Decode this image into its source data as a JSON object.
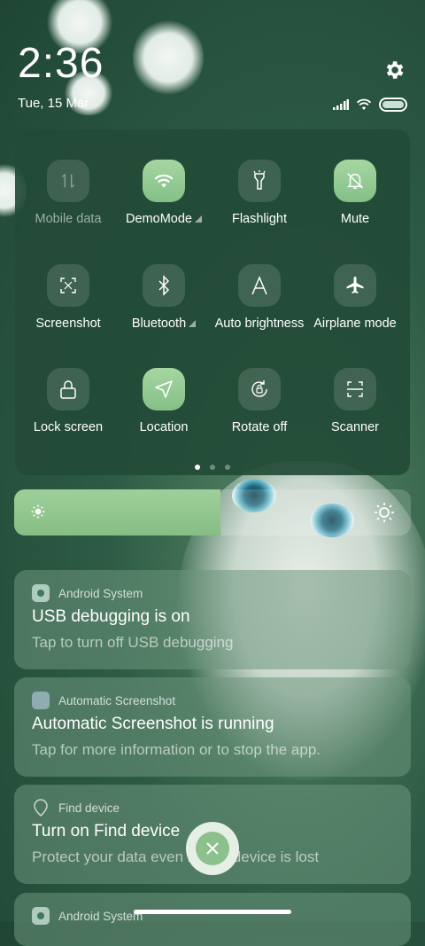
{
  "status_bar": {
    "time": "2:36",
    "date": "Tue, 15 Mar"
  },
  "quick_settings": {
    "tiles": [
      {
        "label": "Mobile data",
        "icon": "mobile-data-icon",
        "active": false,
        "disabled": true
      },
      {
        "label": "DemoMode",
        "icon": "wifi-icon",
        "active": true,
        "expandable": true
      },
      {
        "label": "Flashlight",
        "icon": "flashlight-icon",
        "active": false
      },
      {
        "label": "Mute",
        "icon": "bell-off-icon",
        "active": true
      },
      {
        "label": "Screenshot",
        "icon": "screenshot-icon",
        "active": false
      },
      {
        "label": "Bluetooth",
        "icon": "bluetooth-icon",
        "active": false,
        "expandable": true
      },
      {
        "label": "Auto brightness",
        "icon": "auto-brightness-icon",
        "active": false
      },
      {
        "label": "Airplane mode",
        "icon": "airplane-icon",
        "active": false
      },
      {
        "label": "Lock screen",
        "icon": "lock-icon",
        "active": false
      },
      {
        "label": "Location",
        "icon": "location-icon",
        "active": true
      },
      {
        "label": "Rotate off",
        "icon": "rotate-lock-icon",
        "active": false
      },
      {
        "label": "Scanner",
        "icon": "scanner-icon",
        "active": false
      }
    ],
    "page_count": 3,
    "current_page": 1
  },
  "brightness": {
    "level_fraction": 0.52
  },
  "notifications": [
    {
      "app": "Android System",
      "title": "USB debugging is on",
      "body": "Tap to turn off USB debugging"
    },
    {
      "app": "Automatic Screenshot",
      "title": "Automatic Screenshot is running",
      "body": "Tap for more information or to stop the app."
    },
    {
      "app": "Find device",
      "title": "Turn on Find device",
      "body": "Protect your data even if your device is lost"
    },
    {
      "app": "Android System",
      "title": "",
      "body": ""
    }
  ],
  "colors": {
    "accent": "#8cc08c",
    "panel": "#234b37"
  }
}
